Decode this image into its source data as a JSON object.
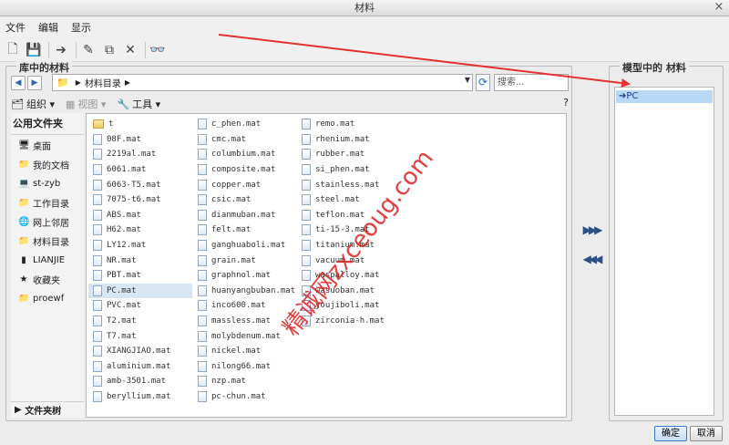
{
  "window": {
    "title": "材料",
    "close_glyph": "×"
  },
  "menu": [
    "文件",
    "编辑",
    "显示"
  ],
  "toolbar": [
    {
      "name": "new-icon",
      "glyph": "🗋"
    },
    {
      "name": "save-icon",
      "glyph": "💾"
    },
    {
      "name": "arrow-right-icon",
      "glyph": "➔"
    },
    {
      "name": "pencil-icon",
      "glyph": "✎"
    },
    {
      "name": "copy-icon",
      "glyph": "⧉"
    },
    {
      "name": "delete-icon",
      "glyph": "✕"
    },
    {
      "name": "glasses-icon",
      "glyph": "👓"
    }
  ],
  "library": {
    "title": "库中的材料",
    "path": [
      "材料目录"
    ],
    "search_placeholder": "搜索...",
    "view": {
      "organize": "组织",
      "view": "视图",
      "tools": "工具",
      "help": "?"
    }
  },
  "sidebar": {
    "header": "公用文件夹",
    "items": [
      {
        "name": "desktop-icon",
        "glyph": "🖥",
        "label": "桌面"
      },
      {
        "name": "documents-icon",
        "glyph": "📁",
        "label": "我的文档"
      },
      {
        "name": "computer-icon",
        "glyph": "💻",
        "label": "st-zyb"
      },
      {
        "name": "workdir-icon",
        "glyph": "📁",
        "label": "工作目录"
      },
      {
        "name": "network-icon",
        "glyph": "🌐",
        "label": "网上邻居"
      },
      {
        "name": "materials-icon",
        "glyph": "📁",
        "label": "材料目录"
      },
      {
        "name": "lianjie-icon",
        "glyph": "▮",
        "label": "LIANJIE"
      },
      {
        "name": "favorites-icon",
        "glyph": "★",
        "label": "收藏夹"
      },
      {
        "name": "proewf-icon",
        "glyph": "📁",
        "label": "proewf"
      }
    ],
    "footer": "文件夹树"
  },
  "files": {
    "col1": [
      "t",
      "08F.mat",
      "2219al.mat",
      "6061.mat",
      "6063-T5.mat",
      "7075-t6.mat",
      "ABS.mat",
      "H62.mat",
      "LY12.mat",
      "NR.mat",
      "PBT.mat",
      "PC.mat",
      "PVC.mat",
      "T2.mat",
      "T7.mat",
      "XIANGJIAO.mat",
      "aluminium.mat",
      "amb-3501.mat",
      "beryllium.mat"
    ],
    "col2": [
      "c_phen.mat",
      "cmc.mat",
      "columbium.mat",
      "composite.mat",
      "copper.mat",
      "csic.mat",
      "dianmuban.mat",
      "felt.mat",
      "ganghuaboli.mat",
      "grain.mat",
      "graphnol.mat",
      "huanyangbuban.mat",
      "inco600.mat",
      "massless.mat",
      "molybdenum.mat",
      "nickel.mat",
      "nilong66.mat",
      "nzp.mat",
      "pc-chun.mat"
    ],
    "col3": [
      "remo.mat",
      "rhenium.mat",
      "rubber.mat",
      "si_phen.mat",
      "stainless.mat",
      "steel.mat",
      "teflon.mat",
      "ti-15-3.mat",
      "titanium.mat",
      "vacuum.mat",
      "waspalloy.mat",
      "wasuoban.mat",
      "youjiboli.mat",
      "zirconia-h.mat"
    ],
    "selected": "PC.mat"
  },
  "model": {
    "title": "模型中的 材料",
    "items": [
      "PC"
    ]
  },
  "move": {
    "add": "▶▶▶",
    "remove": "◀◀◀"
  },
  "buttons": {
    "ok": "确定",
    "cancel": "取消"
  },
  "watermark": "精诚网zxceoug.com",
  "annotation_color": "#e53030"
}
